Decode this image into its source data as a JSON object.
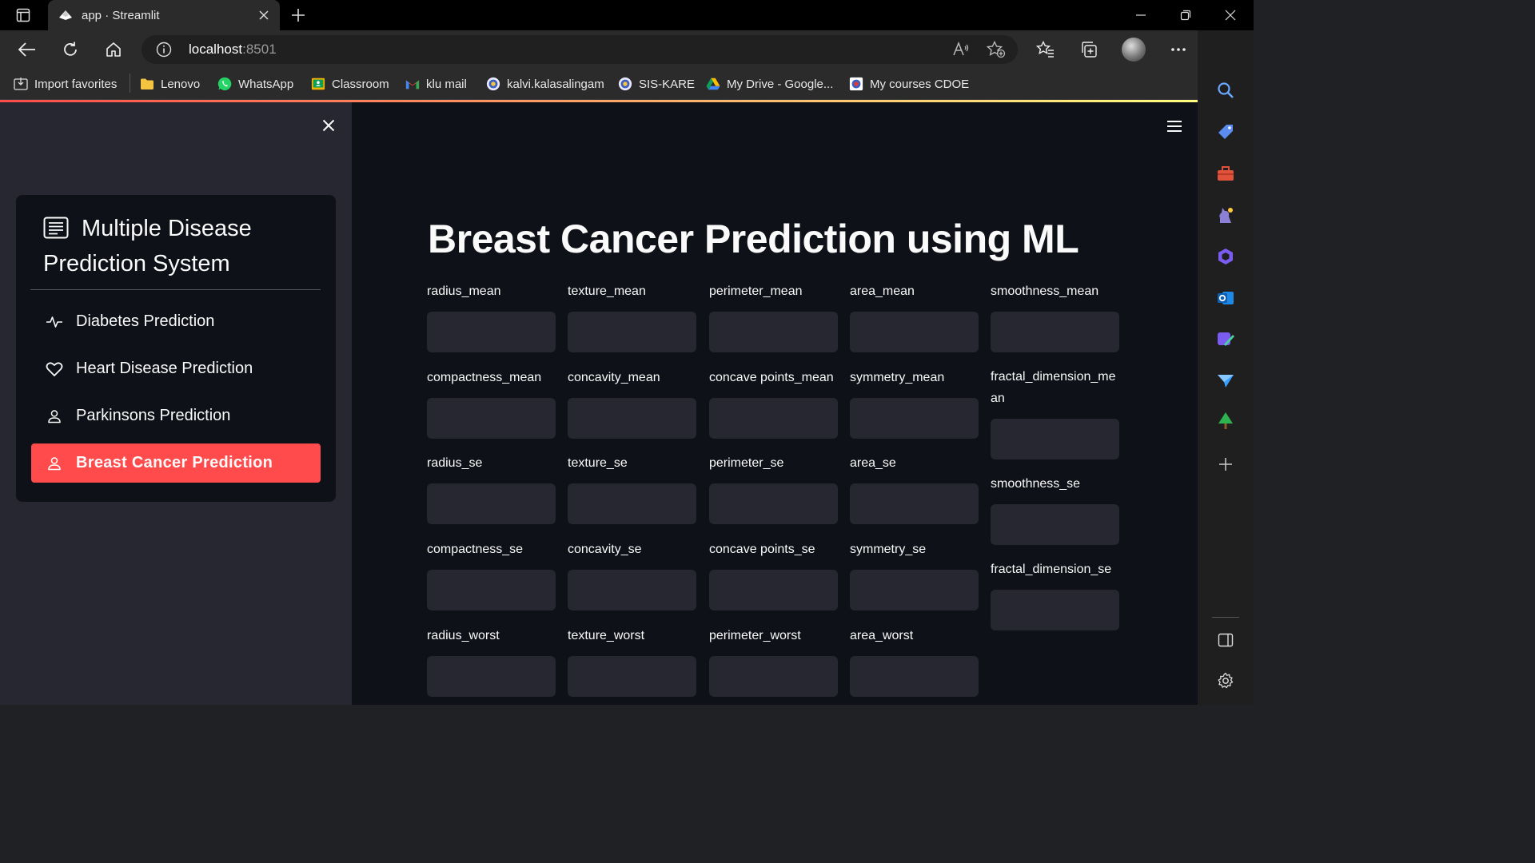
{
  "browser": {
    "tab_title": "app · Streamlit",
    "url_host": "localhost",
    "url_port": ":8501",
    "bookmarks": [
      {
        "label": "Import favorites",
        "icon": "import-icon"
      },
      {
        "label": "Lenovo",
        "icon": "folder-icon"
      },
      {
        "label": "WhatsApp",
        "icon": "whatsapp-icon"
      },
      {
        "label": "Classroom",
        "icon": "classroom-icon"
      },
      {
        "label": "klu mail",
        "icon": "gmail-icon"
      },
      {
        "label": "kalvi.kalasalingam",
        "icon": "kalasalingam-icon"
      },
      {
        "label": "SIS-KARE",
        "icon": "kalasalingam-icon"
      },
      {
        "label": "My Drive - Google...",
        "icon": "drive-icon"
      },
      {
        "label": "My courses CDOE",
        "icon": "cdoe-icon"
      }
    ]
  },
  "sidebar": {
    "menu_title": "Multiple Disease Prediction System",
    "items": [
      {
        "label": "Diabetes Prediction",
        "icon": "activity-icon",
        "active": false
      },
      {
        "label": "Heart Disease Prediction",
        "icon": "heart-icon",
        "active": false
      },
      {
        "label": "Parkinsons Prediction",
        "icon": "person-icon",
        "active": false
      },
      {
        "label": "Breast Cancer Prediction",
        "icon": "person-icon",
        "active": true
      }
    ]
  },
  "main": {
    "title": "Breast Cancer Prediction using ML",
    "fields": [
      "radius_mean",
      "texture_mean",
      "perimeter_mean",
      "area_mean",
      "smoothness_mean",
      "compactness_mean",
      "concavity_mean",
      "concave points_mean",
      "symmetry_mean",
      "fractal_dimension_mean",
      "radius_se",
      "texture_se",
      "perimeter_se",
      "area_se",
      "smoothness_se",
      "compactness_se",
      "concavity_se",
      "concave points_se",
      "symmetry_se",
      "fractal_dimension_se",
      "radius_worst",
      "texture_worst",
      "perimeter_worst",
      "area_worst"
    ]
  },
  "colors": {
    "accent": "#ff4b4b",
    "app_background": "#0e1117",
    "sidebar_background": "#262730",
    "input_background": "#262730"
  }
}
